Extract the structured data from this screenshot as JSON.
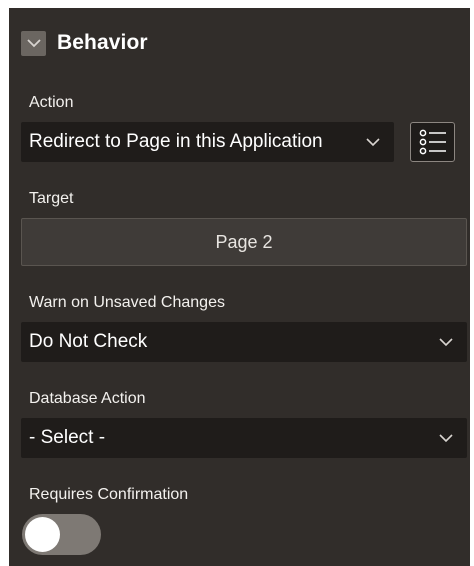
{
  "section": {
    "title": "Behavior",
    "collapse_icon": "chevron-down-icon"
  },
  "fields": {
    "action": {
      "label": "Action",
      "value": "Redirect to Page in this Application",
      "list_icon": "list-icon"
    },
    "target": {
      "label": "Target",
      "value": "Page 2"
    },
    "warn_unsaved": {
      "label": "Warn on Unsaved Changes",
      "value": "Do Not Check"
    },
    "database_action": {
      "label": "Database Action",
      "value": "- Select -"
    },
    "requires_confirmation": {
      "label": "Requires Confirmation",
      "on": false
    }
  },
  "colors": {
    "panel_bg": "#312d2a",
    "field_bg": "#1f1c1a",
    "text": "#ffffff"
  }
}
